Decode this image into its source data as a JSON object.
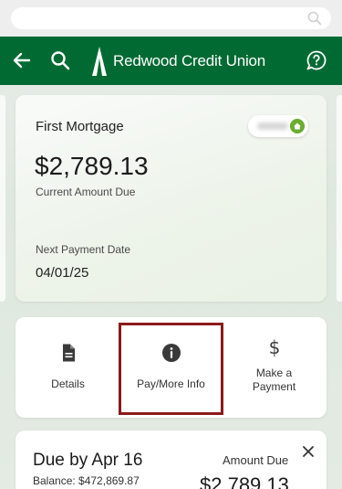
{
  "header": {
    "brand": "Redwood Credit Union"
  },
  "account": {
    "name": "First Mortgage",
    "amount": "$2,789.13",
    "amount_label": "Current Amount Due",
    "next_payment_label": "Next Payment Date",
    "next_payment_date": "04/01/25"
  },
  "actions": {
    "details": "Details",
    "pay_more_info": "Pay/More Info",
    "make_payment_line1": "Make a",
    "make_payment_line2": "Payment"
  },
  "due": {
    "title": "Due by Apr 16",
    "balance": "Balance: $472,869.87",
    "amount_label": "Amount Due",
    "amount_value": "$2,789.13"
  },
  "colors": {
    "brand_green": "#006a33",
    "highlight": "#8b1a1a",
    "home_badge": "#6aae2e"
  },
  "icons": [
    "search-icon",
    "back-arrow-icon",
    "help-chat-icon",
    "home-icon",
    "document-icon",
    "info-icon",
    "dollar-icon",
    "close-icon"
  ]
}
